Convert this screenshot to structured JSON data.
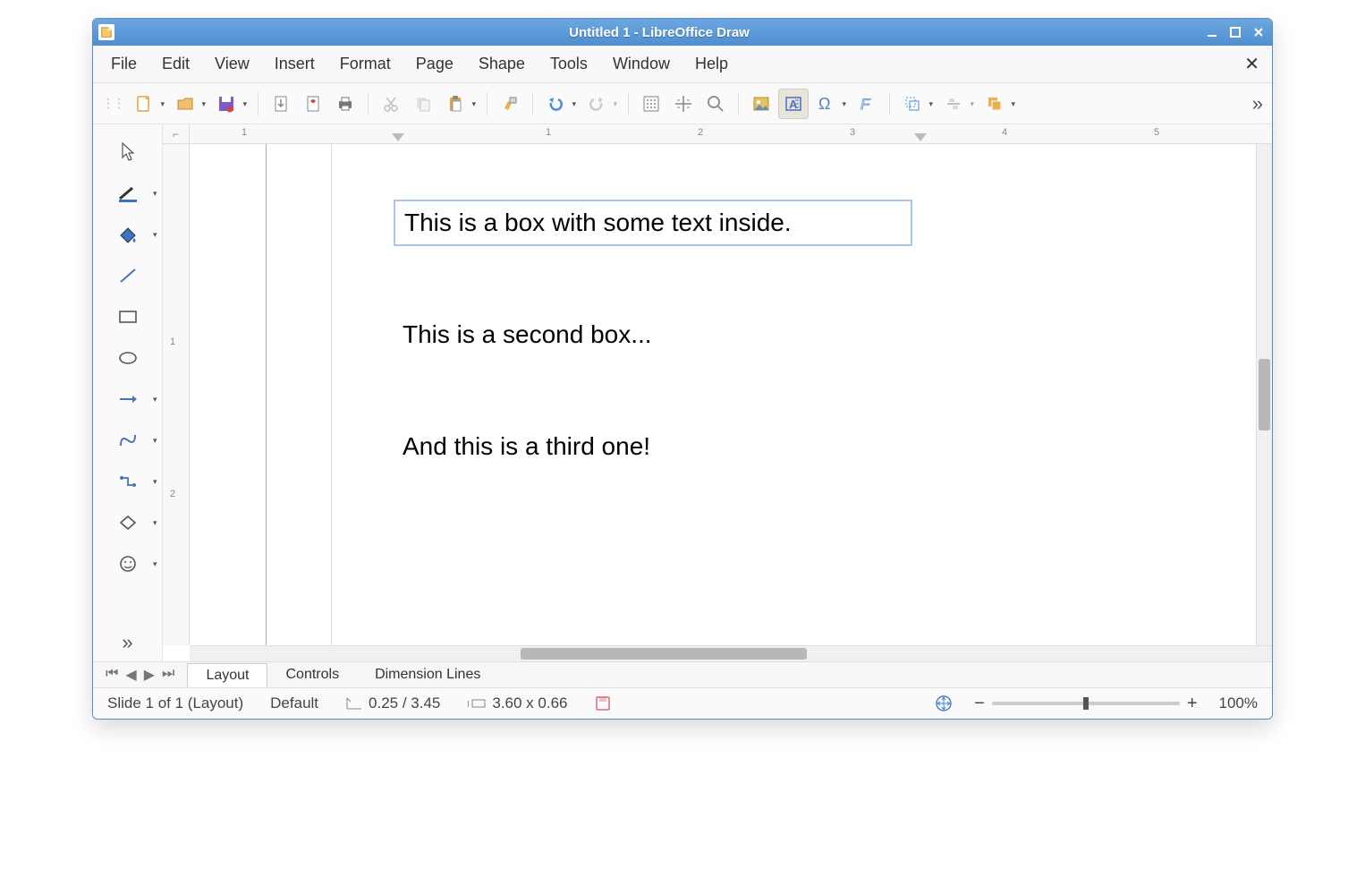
{
  "title": "Untitled 1 - LibreOffice Draw",
  "menu": [
    "File",
    "Edit",
    "View",
    "Insert",
    "Format",
    "Page",
    "Shape",
    "Tools",
    "Window",
    "Help"
  ],
  "toolbar": {
    "icons": [
      "new",
      "open",
      "save",
      "export",
      "export-pdf",
      "print",
      "cut",
      "copy",
      "paste",
      "clone-format",
      "undo",
      "redo",
      "grid",
      "snap",
      "zoom",
      "image",
      "textbox",
      "special-char",
      "fontwork",
      "transform",
      "align",
      "arrange"
    ]
  },
  "side_tools": [
    "select",
    "line-color",
    "fill",
    "line",
    "rectangle",
    "ellipse",
    "arrow",
    "curve",
    "connector",
    "basic-shapes",
    "symbol"
  ],
  "h_ruler_marks": [
    "1",
    "1",
    "2",
    "3",
    "4",
    "5"
  ],
  "v_ruler_marks": [
    "1",
    "2"
  ],
  "canvas": {
    "box1": "This is a box with some text inside.",
    "box2": "This is a second box...",
    "box3": "And this is a third one!"
  },
  "tabs": {
    "t1": "Layout",
    "t2": "Controls",
    "t3": "Dimension Lines"
  },
  "status": {
    "slide": "Slide 1 of 1 (Layout)",
    "style": "Default",
    "pos": "0.25 / 3.45",
    "size": "3.60 x 0.66",
    "zoom": "100%"
  }
}
